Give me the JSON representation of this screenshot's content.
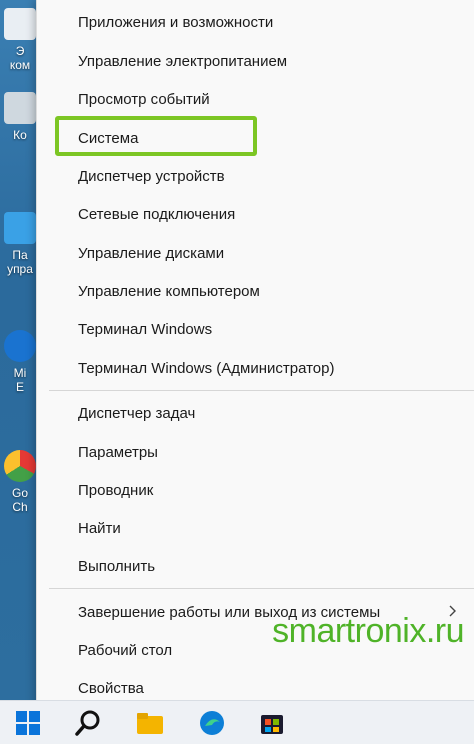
{
  "desktop": {
    "items": [
      {
        "label": "Э\nком",
        "color": "#e9eef3"
      },
      {
        "label": "Ко",
        "color": "#cfd8df"
      },
      {
        "label": "Па\nупра",
        "color": "#3aa1e6"
      },
      {
        "label": "Mi\nE",
        "color": "#1a73d0"
      },
      {
        "label": "Go\nCh",
        "color": "#e53935"
      }
    ]
  },
  "menu": {
    "groups": [
      [
        "Приложения и возможности",
        "Управление электропитанием",
        "Просмотр событий",
        "Система",
        "Диспетчер устройств",
        "Сетевые подключения",
        "Управление дисками",
        "Управление компьютером",
        "Терминал Windows",
        "Терминал Windows (Администратор)"
      ],
      [
        "Диспетчер задач",
        "Параметры",
        "Проводник",
        "Найти",
        "Выполнить"
      ],
      [
        "Завершение работы или выход из системы",
        "Рабочий стол",
        "Свойства"
      ]
    ],
    "highlighted": "Система",
    "highlight_color": "#7cc624"
  },
  "taskbar": {
    "icons": [
      "windows-start-icon",
      "search-icon",
      "file-explorer-icon",
      "edge-icon",
      "store-icon"
    ]
  },
  "watermark": "smartronix.ru"
}
